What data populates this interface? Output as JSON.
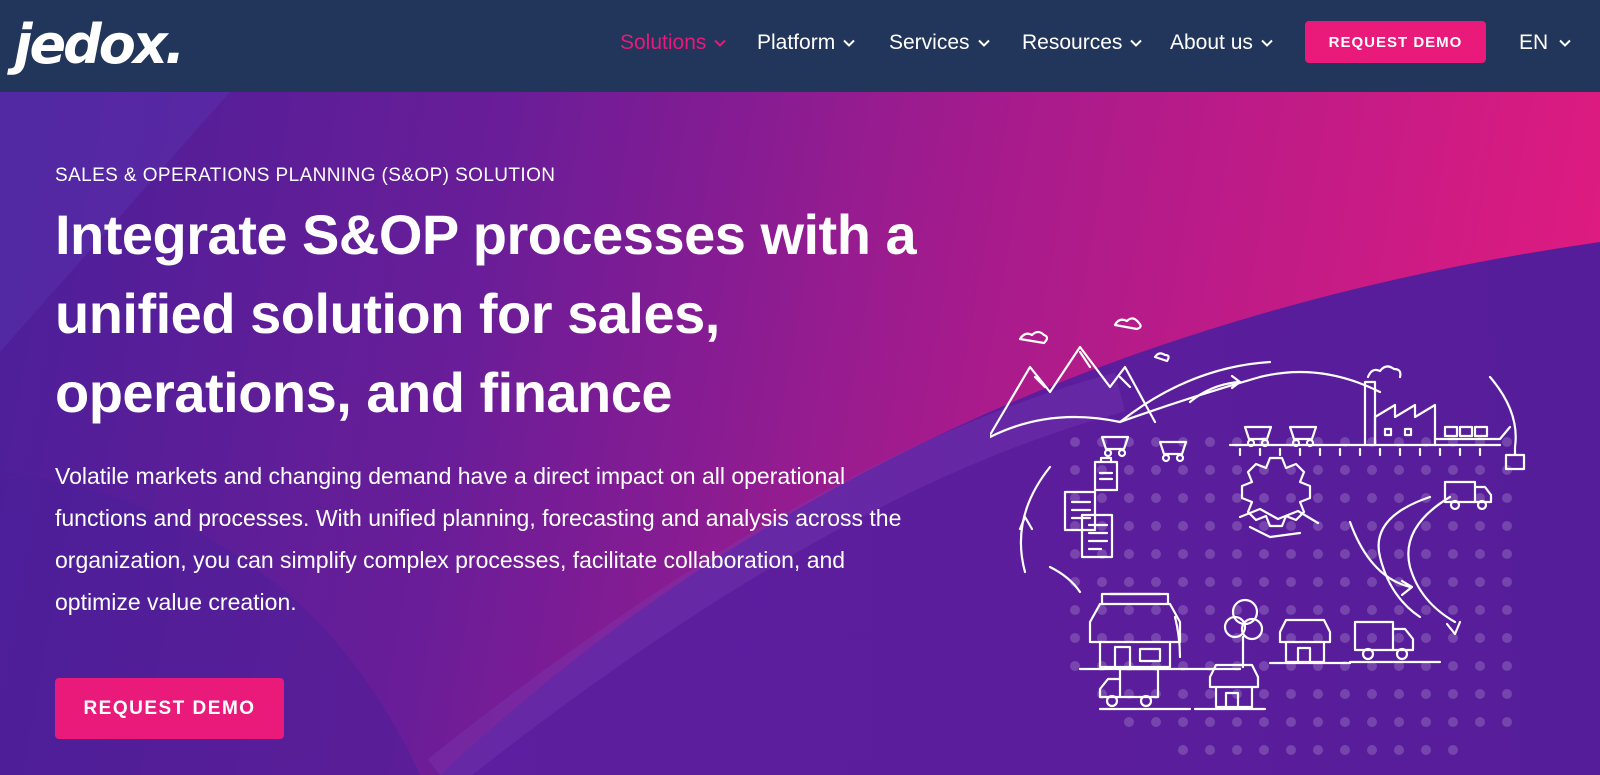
{
  "brand": {
    "logo_text": "jedox."
  },
  "nav": {
    "items": [
      {
        "label": "Solutions",
        "active": true
      },
      {
        "label": "Platform",
        "active": false
      },
      {
        "label": "Services",
        "active": false
      },
      {
        "label": "Resources",
        "active": false
      },
      {
        "label": "About us",
        "active": false
      }
    ],
    "cta_label": "REQUEST DEMO",
    "language": "EN"
  },
  "hero": {
    "eyebrow": "SALES & OPERATIONS PLANNING (S&OP) SOLUTION",
    "headline": "Integrate S&OP processes with a unified solution for sales, operations, and finance",
    "body": "Volatile markets and changing demand have a direct impact on all operational functions and processes. With unified planning, forecasting and analysis across the organization, you can simplify complex processes, facilitate collaboration, and optimize value creation.",
    "cta_label": "REQUEST DEMO"
  },
  "colors": {
    "nav_bg": "#22355b",
    "accent": "#ea1a7b",
    "hero_gradient_start": "#4b1f99",
    "hero_gradient_end": "#e61b7e"
  }
}
